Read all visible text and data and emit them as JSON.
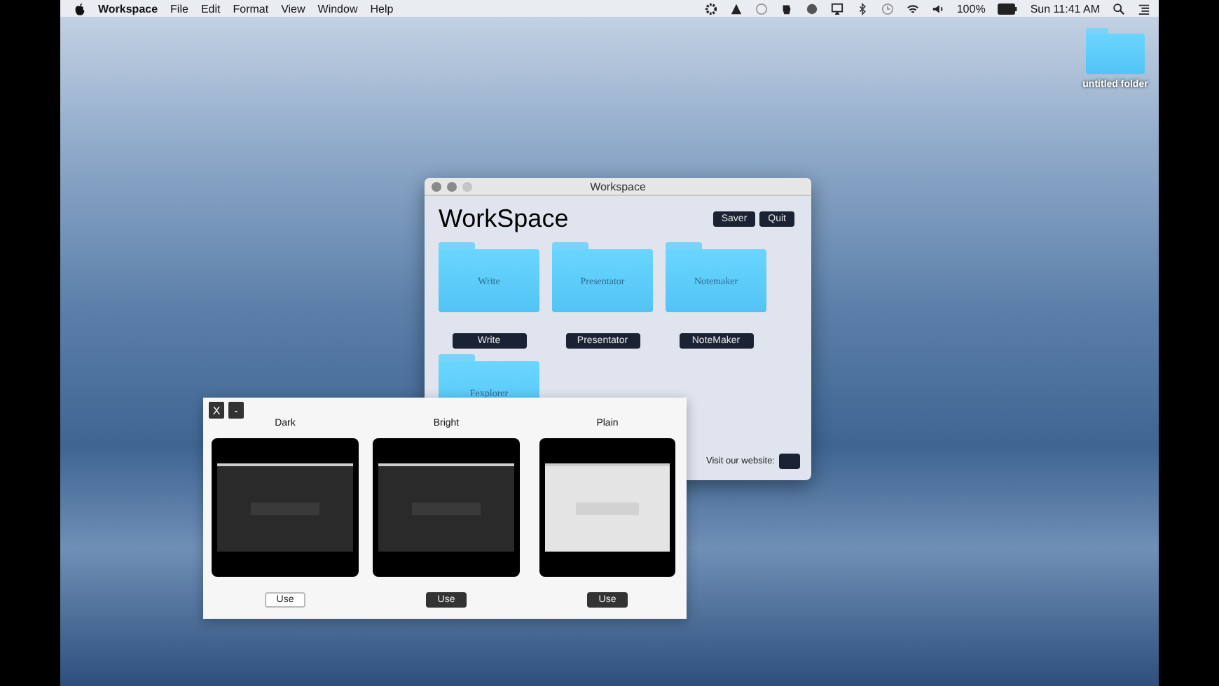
{
  "menu_bar": {
    "app_name": "Workspace",
    "menus": [
      "File",
      "Edit",
      "Format",
      "View",
      "Window",
      "Help"
    ],
    "battery": "100%",
    "clock": "Sun 11:41 AM"
  },
  "desktop_icons": [
    {
      "label": "untitled folder"
    }
  ],
  "workspace_window": {
    "title": "Workspace",
    "heading": "WorkSpace",
    "buttons": [
      "Saver",
      "Quit"
    ],
    "apps": [
      {
        "folder_text": "Write",
        "button": "Write"
      },
      {
        "folder_text": "Presentator",
        "button": "Presentator"
      },
      {
        "folder_text": "Notemaker",
        "button": "NoteMaker"
      },
      {
        "folder_text": "Fexplorer"
      }
    ],
    "website_label": "Visit our website:"
  },
  "theme_panel": {
    "buttons": [
      "X",
      "-"
    ],
    "themes": [
      {
        "name": "Dark",
        "kind": "dark",
        "button": "Use",
        "selected": true
      },
      {
        "name": "Bright",
        "kind": "dark",
        "button": "Use",
        "selected": false
      },
      {
        "name": "Plain",
        "kind": "light",
        "button": "Use",
        "selected": false
      }
    ]
  }
}
